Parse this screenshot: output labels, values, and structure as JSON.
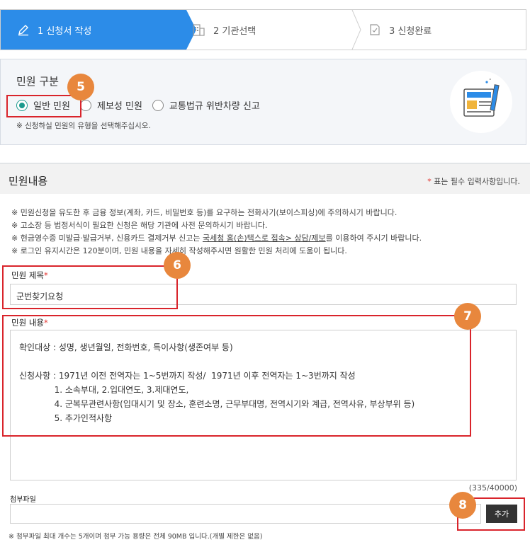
{
  "stepper": {
    "steps": [
      {
        "label": "1 신청서 작성",
        "icon": "pencil-icon"
      },
      {
        "label": "2 기관선택",
        "icon": "building-icon"
      },
      {
        "label": "3 신청완료",
        "icon": "document-check-icon"
      }
    ],
    "active_color": "#2c8ce8"
  },
  "category": {
    "title": "민원 구분",
    "options": [
      "일반 민원",
      "제보성 민원",
      "교통법규 위반차량 신고"
    ],
    "selected": "일반 민원",
    "note": "※ 신청하실 민원의 유형을 선택해주십시오.",
    "illustration_icon": "document-form-icon"
  },
  "content": {
    "title": "민원내용",
    "required_star": "*",
    "required_text": " 표는 필수 입력사항입니다.",
    "notices": [
      "※ 민원신청을 유도한 후 금융 정보(계좌, 카드, 비밀번호 등)를 요구하는 전화사기(보이스피싱)에 주의하시기 바랍니다.",
      "※ 고소장 등 법정서식이 필요한 신청은 해당 기관에 사전 문의하시기 바랍니다."
    ],
    "notice3_pre": "※ 현금영수증 미발급·발급거부, 신용카드 결제거부 신고는 ",
    "notice3_link": "국세청 홈(손)택스로 접속> 상담/제보",
    "notice3_post": "를 이용하여 주시기 바랍니다.",
    "notice4": "※ 로그인 유지시간은 120분이며, 민원 내용을 자세히 작성해주시면 원활한 민원 처리에 도움이 됩니다."
  },
  "form": {
    "title_label": "민원 제목",
    "title_value": "군번찾기요청",
    "body_label": "민원 내용",
    "star": "*",
    "body_lines": [
      "확인대상 : 성명, 생년월일, 전화번호, 특이사항(생존여부 등)",
      "",
      "신청사항 : 1971년 이전 전역자는 1~5번까지 작성/  1971년 이후 전역자는 1~3번까지 작성",
      "             1. 소속부대, 2.입대연도, 3.제대연도,",
      "             4. 군복무관련사항(입대시기 및 장소, 훈련소명, 근무부대명, 전역시기와 계급, 전역사유, 부상부위 등)",
      "             5. 추가인적사항"
    ],
    "counter": "(335/40000)",
    "file_label": "첨부파일",
    "add_button": "추가",
    "file_note": "※ 첨부파일 최대 개수는 5개이며 첨부 가능 용량은 전체 90MB 입니다.(개별 제한은 없음)"
  },
  "annotations": {
    "badges": [
      "5",
      "6",
      "7",
      "8"
    ],
    "badge_color": "#e8873d",
    "box_color": "#d9242b"
  }
}
